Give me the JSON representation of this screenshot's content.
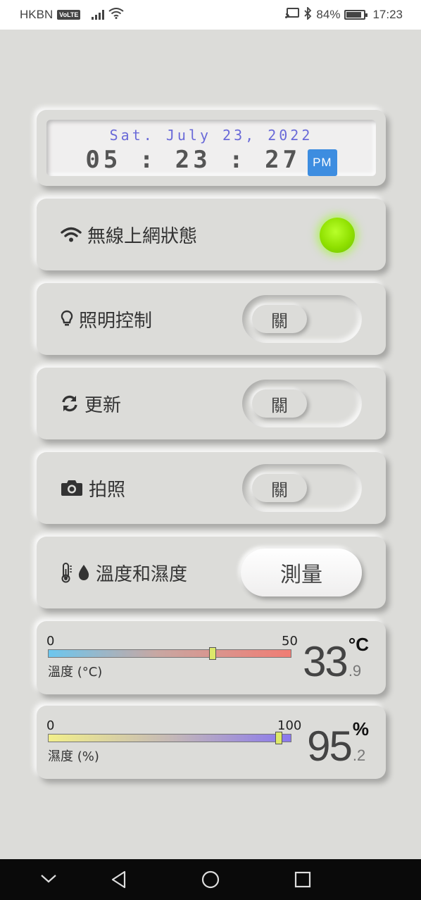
{
  "status_bar": {
    "carrier": "HKBN",
    "volte": "VoLTE",
    "battery": "84%",
    "time": "17:23",
    "battery_level": 0.84
  },
  "clock": {
    "date": "Sat. July 23, 2022",
    "time": "05 : 23 : 27",
    "ampm": "PM"
  },
  "wifi": {
    "label": "無線上網狀態",
    "status_color": "#8fe000"
  },
  "lighting": {
    "label": "照明控制",
    "toggle_label": "關"
  },
  "refresh": {
    "label": "更新",
    "toggle_label": "關"
  },
  "photo": {
    "label": "拍照",
    "toggle_label": "關"
  },
  "climate": {
    "label": "溫度和濕度",
    "button_label": "測量"
  },
  "temperature": {
    "min": "0",
    "max": "50",
    "caption": "溫度 (°C)",
    "value": 33.9,
    "integer": "33",
    "decimal": ".9",
    "unit": "°C"
  },
  "humidity": {
    "min": "0",
    "max": "100",
    "caption": "濕度 (%)",
    "value": 95.2,
    "integer": "95",
    "decimal": ".2",
    "unit": "%"
  },
  "icons": {
    "wifi": "wifi-icon",
    "lightbulb": "lightbulb-icon",
    "refresh": "refresh-icon",
    "camera": "camera-icon",
    "thermometer": "thermometer-icon",
    "droplet": "droplet-icon"
  }
}
